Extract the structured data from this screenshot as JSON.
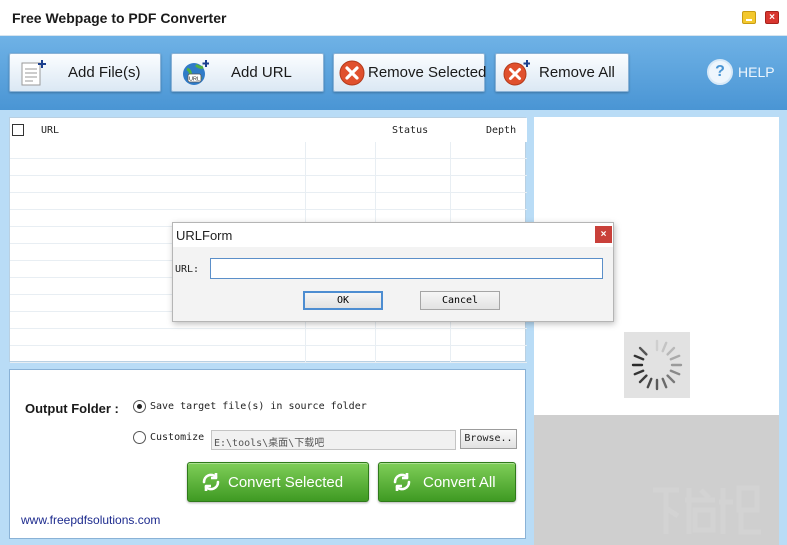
{
  "app": {
    "title": "Free Webpage to PDF Converter"
  },
  "toolbar": {
    "add_files": "Add File(s)",
    "add_url": "Add URL",
    "remove_selected": "Remove Selected",
    "remove_all": "Remove All",
    "help": "HELP"
  },
  "file_list": {
    "columns": {
      "url": "URL",
      "status": "Status",
      "depth": "Depth"
    },
    "rows": []
  },
  "output": {
    "label": "Output Folder :",
    "save_option": "Save target file(s) in source folder",
    "customize_option": "Customize",
    "path_value": "E:\\tools\\桌面\\下载吧",
    "browse": "Browse..",
    "selected_option": "save_in_source"
  },
  "actions": {
    "convert_selected": "Convert Selected",
    "convert_all": "Convert All"
  },
  "footer": {
    "link": "www.freepdfsolutions.com"
  },
  "dialog": {
    "title": "URLForm",
    "url_label": "URL:",
    "url_value": "",
    "ok": "OK",
    "cancel": "Cancel"
  },
  "colors": {
    "toolbar_blue": "#4a95d4",
    "convert_green": "#3f9a23",
    "remove_red": "#e0502d",
    "link_blue": "#1d2b8e"
  }
}
